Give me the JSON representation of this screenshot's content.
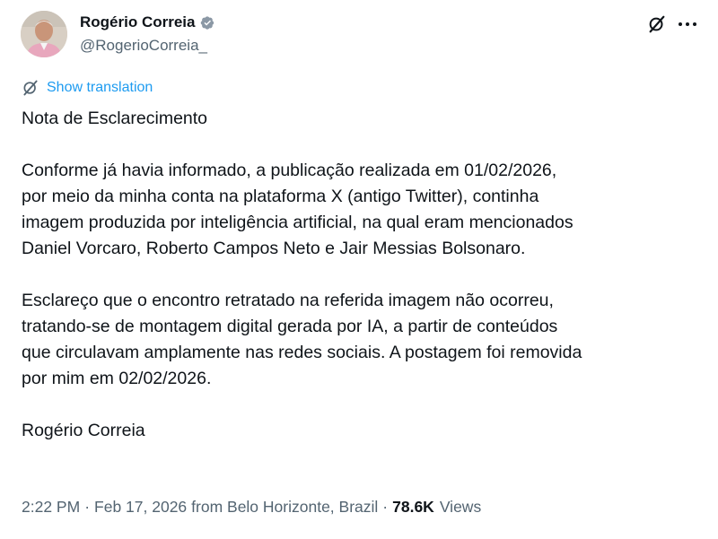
{
  "author": {
    "display_name": "Rogério Correia",
    "handle": "@RogerioCorreia_"
  },
  "translate_label": "Show translation",
  "post": {
    "title": "Nota de Esclarecimento",
    "p1_lines": [
      "Conforme já havia informado, a publicação realizada em 01/02/2026,",
      "por meio da minha conta na plataforma X (antigo Twitter), continha",
      "imagem produzida por inteligência artificial, na qual eram mencionados",
      "Daniel Vorcaro, Roberto Campos Neto e Jair Messias Bolsonaro."
    ],
    "p2_lines": [
      "Esclareço que o encontro retratado na referida imagem não ocorreu,",
      "tratando-se de montagem digital gerada por IA, a partir de conteúdos",
      "que circulavam amplamente nas redes sociais. A postagem foi removida",
      "por mim em 02/02/2026."
    ],
    "signature": "Rogério Correia"
  },
  "meta": {
    "time": "2:22 PM",
    "date": "Feb 17, 2026",
    "location": "from Belo Horizonte, Brazil",
    "views_count": "78.6K",
    "views_label": "Views"
  },
  "colors": {
    "verified": "#1d9bf0",
    "link": "#1d9bf0",
    "muted": "#536471"
  },
  "icons": [
    "verified-badge-icon",
    "grok-icon",
    "more-icon",
    "translate-icon"
  ]
}
